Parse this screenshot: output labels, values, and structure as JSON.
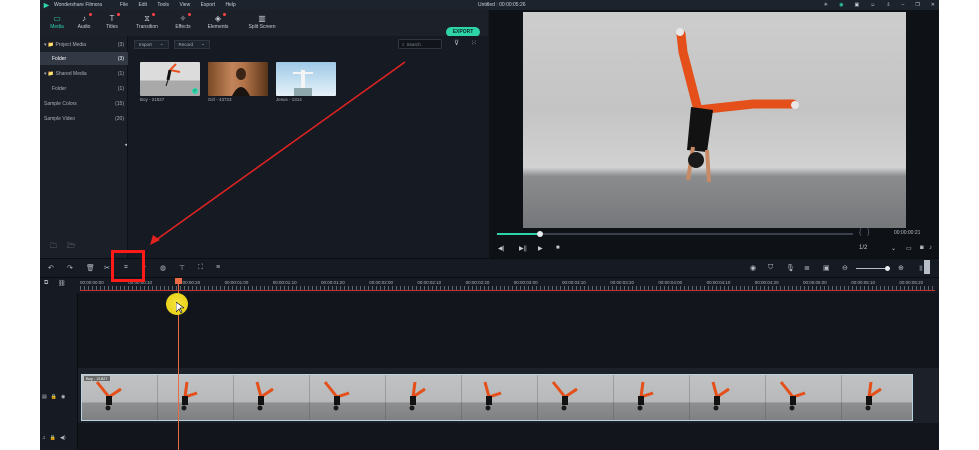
{
  "titlebar": {
    "app_name": "Wondershare Filmora",
    "menus": [
      "File",
      "Edit",
      "Tools",
      "View",
      "Export",
      "Help"
    ],
    "document_title": "Untitled : 00:00:05:26"
  },
  "toolbar": {
    "tabs": [
      {
        "label": "Media",
        "icon": "media-folder-icon",
        "active": true
      },
      {
        "label": "Audio",
        "icon": "music-note-icon",
        "dot": true
      },
      {
        "label": "Titles",
        "icon": "text-t-icon",
        "dot": true
      },
      {
        "label": "Transition",
        "icon": "transition-icon",
        "dot": true
      },
      {
        "label": "Effects",
        "icon": "effects-icon",
        "dot": true
      },
      {
        "label": "Elements",
        "icon": "elements-icon",
        "dot": true
      },
      {
        "label": "Split Screen",
        "icon": "split-screen-icon"
      }
    ],
    "export_label": "EXPORT",
    "accent_color": "#2dd4a8"
  },
  "sidebar": {
    "items": [
      {
        "label": "▾ 📁 Project Media",
        "count": "(3)"
      },
      {
        "label": "Folder",
        "count": "(3)",
        "selected": true
      },
      {
        "label": "▾ 📁 Shared Media",
        "count": "(1)"
      },
      {
        "label": "Folder",
        "count": "(1)"
      },
      {
        "label": "Sample Colors",
        "count": "(15)"
      },
      {
        "label": "Sample Video",
        "count": "(20)"
      }
    ]
  },
  "media": {
    "import_label": "Import",
    "record_label": "Record",
    "search_placeholder": "Search",
    "thumbnails": [
      {
        "label": "Boy - 21827",
        "checked": true
      },
      {
        "label": "Girl - 43723"
      },
      {
        "label": "Jesus - 1314"
      }
    ]
  },
  "preview": {
    "time": "00:00:00:21",
    "progress_fraction": 0.12,
    "quality": "1/2"
  },
  "ruler": {
    "labels": [
      "00:00:00:00",
      "00:00:00:10",
      "00:00:00:20",
      "00:00:01:00",
      "00:00:01:10",
      "00:00:01:20",
      "00:00:02:00",
      "00:00:02:10",
      "00:00:02:20",
      "00:00:03:00",
      "00:00:03:10",
      "00:00:03:20",
      "00:00:04:00",
      "00:00:04:10",
      "00:00:04:20",
      "00:00:05:00",
      "00:00:05:10",
      "00:00:05:20"
    ]
  },
  "clip": {
    "label": "Boy - 21827"
  }
}
